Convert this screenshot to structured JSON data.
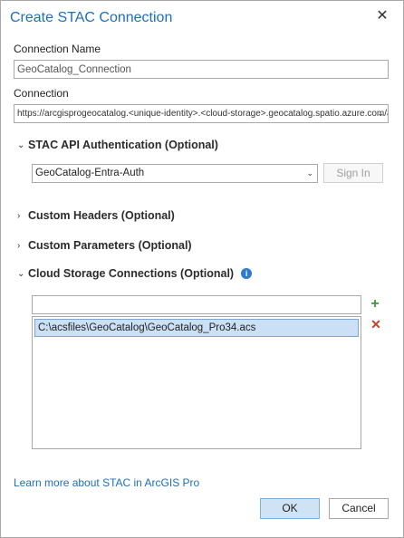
{
  "dialog": {
    "title": "Create STAC Connection",
    "close_glyph": "✕"
  },
  "connection_name": {
    "label": "Connection Name",
    "value": "GeoCatalog_Connection"
  },
  "connection": {
    "label": "Connection",
    "value": "https://arcgisprogeocatalog.<unique-identity>.<cloud-storage>.geocatalog.spatio.azure.com/api"
  },
  "auth": {
    "heading": "STAC API Authentication (Optional)",
    "selected": "GeoCatalog-Entra-Auth",
    "sign_in_label": "Sign In"
  },
  "sections": {
    "custom_headers": "Custom Headers (Optional)",
    "custom_parameters": "Custom Parameters (Optional)",
    "cloud_storage": "Cloud Storage Connections (Optional)"
  },
  "cloud_storage": {
    "input_value": "",
    "items": [
      "C:\\acsfiles\\GeoCatalog\\GeoCatalog_Pro34.acs"
    ],
    "add_glyph": "+",
    "remove_glyph": "✕",
    "add_color": "#3c9a3c",
    "remove_color": "#c4412b"
  },
  "footer": {
    "learn_more": "Learn more about STAC in ArcGIS Pro",
    "ok_label": "OK",
    "cancel_label": "Cancel"
  },
  "icons": {
    "collapsed": "›",
    "expanded": "⌄",
    "dropdown": "⌄",
    "info": "i"
  }
}
